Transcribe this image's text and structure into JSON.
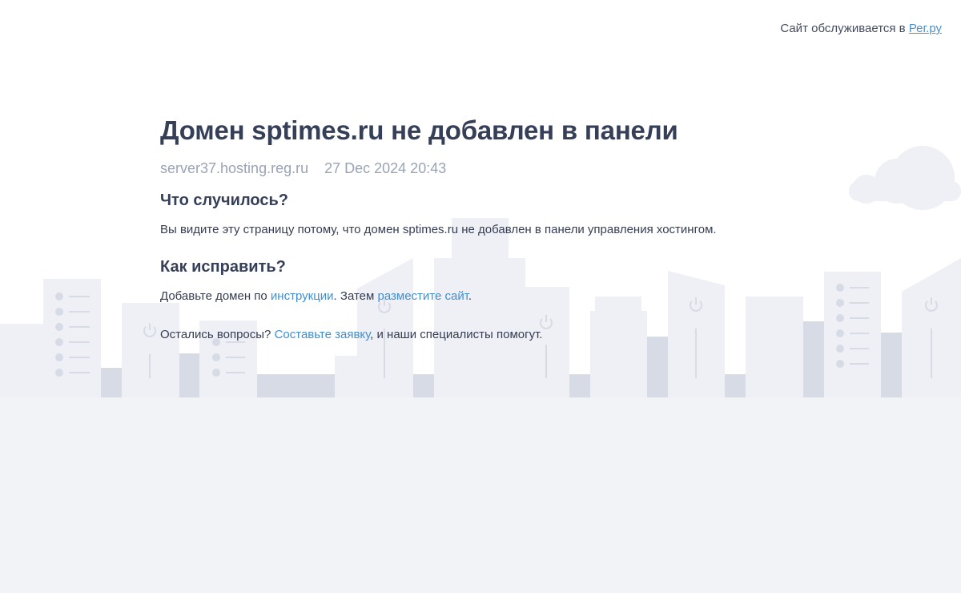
{
  "header": {
    "served_by_text": "Сайт обслуживается в ",
    "served_by_link": "Рег.ру"
  },
  "main": {
    "title": "Домен sptimes.ru не добавлен в панели",
    "server": "server37.hosting.reg.ru",
    "datetime": "27 Dec 2024 20:43",
    "what_heading": "Что случилось?",
    "what_text": "Вы видите эту страницу потому, что домен sptimes.ru не добавлен в панели управления хостингом.",
    "how_heading": "Как исправить?",
    "how_text_1": "Добавьте домен по ",
    "how_link_1": "инструкции",
    "how_text_2": ". Затем ",
    "how_link_2": "разместите сайт",
    "how_text_3": ".",
    "ask_text_1": "Остались вопросы? ",
    "ask_link": "Составьте заявку",
    "ask_text_2": ", и наши специалисты помогут."
  },
  "colors": {
    "title": "#353f58",
    "muted": "#9aa3b4",
    "link": "#3f8fd1",
    "city_light": "#eef0f5",
    "city_dark": "#d6dbe6",
    "ground": "#f2f3f7"
  }
}
